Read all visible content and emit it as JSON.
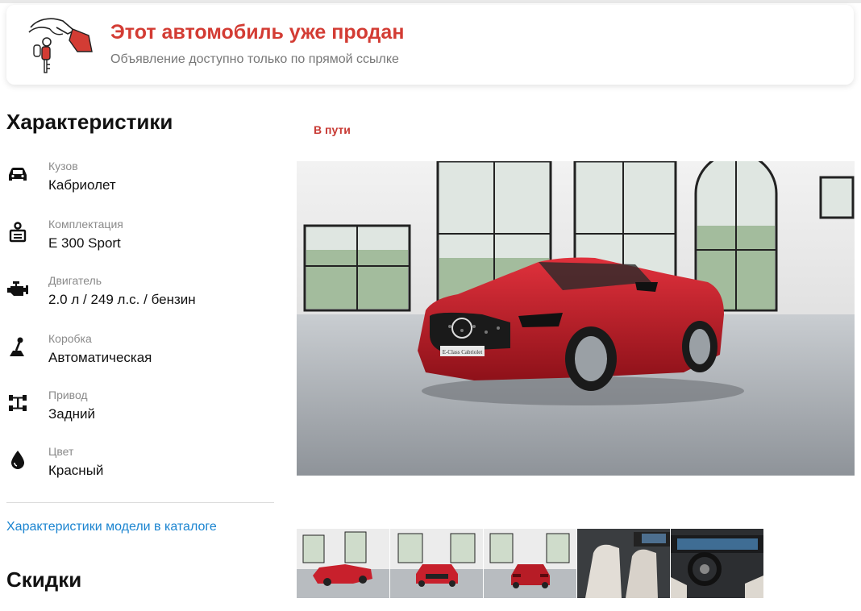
{
  "banner": {
    "title": "Этот автомобиль уже продан",
    "subtitle": "Объявление доступно только по прямой ссылке",
    "accent_color": "#d33c34"
  },
  "specs": {
    "title": "Характеристики",
    "items": [
      {
        "icon": "car-body-icon",
        "label": "Кузов",
        "value": "Кабриолет"
      },
      {
        "icon": "trim-badge-icon",
        "label": "Комплектация",
        "value": "E 300 Sport"
      },
      {
        "icon": "engine-icon",
        "label": "Двигатель",
        "value": "2.0 л / 249 л.с. / бензин"
      },
      {
        "icon": "gear-stick-icon",
        "label": "Коробка",
        "value": "Автоматическая"
      },
      {
        "icon": "drivetrain-icon",
        "label": "Привод",
        "value": "Задний"
      },
      {
        "icon": "paint-drop-icon",
        "label": "Цвет",
        "value": "Красный"
      }
    ],
    "catalog_link": "Характеристики модели в каталоге"
  },
  "discounts": {
    "title": "Скидки"
  },
  "gallery": {
    "status": "В пути",
    "status_color": "#c83a34",
    "plate_text": "E-Class Cabriolet",
    "car_color": "#c8202c",
    "thumbnails": [
      "exterior-front-side",
      "exterior-front",
      "exterior-rear",
      "interior-seats",
      "interior-dashboard"
    ]
  },
  "links": {
    "color": "#1a84d0"
  }
}
